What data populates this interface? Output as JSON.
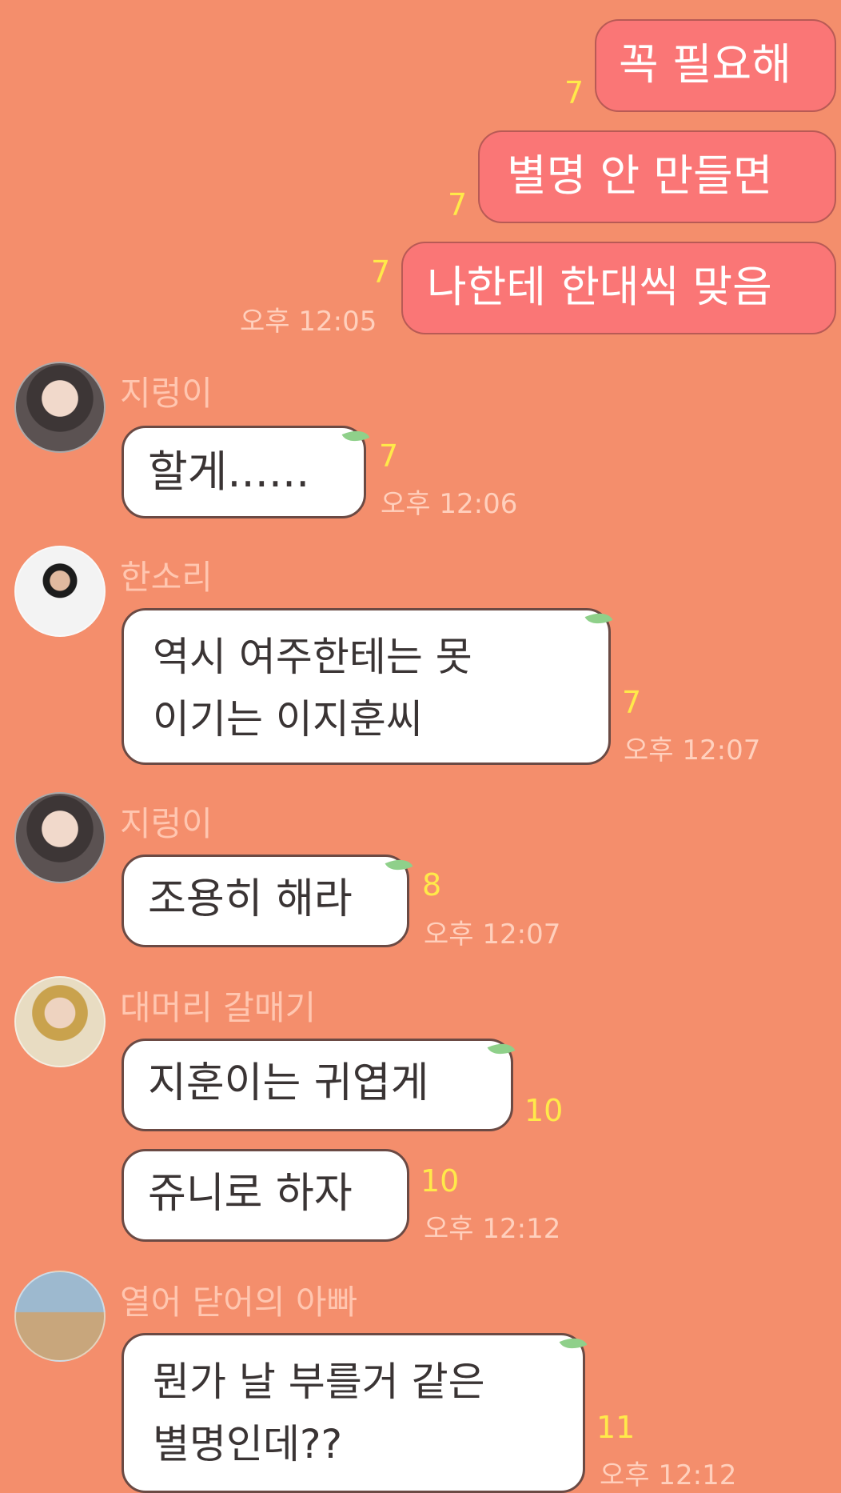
{
  "colors": {
    "background": "#f48e6c",
    "my_bubble": "#fa7676",
    "their_bubble": "#ffffff",
    "unread_count": "#ffe94a",
    "timestamp": "#ffd0bd",
    "sender_name": "#ffc6b0"
  },
  "outgoing": {
    "msg1": {
      "text": "꼭 필요해",
      "unread": "7"
    },
    "msg2": {
      "text": "별명 안 만들면",
      "unread": "7"
    },
    "msg3": {
      "text": "나한테 한대씩 맞음",
      "unread": "7",
      "time": "오후 12:05"
    }
  },
  "group1": {
    "sender": "지렁이",
    "avatar_icon": "profile-photo-icon",
    "msg1": {
      "text": "할게......",
      "unread": "7",
      "time": "오후 12:06"
    }
  },
  "group2": {
    "sender": "한소리",
    "avatar_icon": "profile-photo-icon",
    "msg1": {
      "text": "역시 여주한테는 못\n이기는 이지훈씨",
      "unread": "7",
      "time": "오후 12:07"
    }
  },
  "group3": {
    "sender": "지렁이",
    "avatar_icon": "profile-photo-icon",
    "msg1": {
      "text": "조용히 해라",
      "unread": "8",
      "time": "오후 12:07"
    }
  },
  "group4": {
    "sender": "대머리 갈매기",
    "avatar_icon": "profile-photo-icon",
    "msg1": {
      "text": "지훈이는 귀엽게",
      "unread": "10"
    },
    "msg2": {
      "text": "쥬니로 하자",
      "unread": "10",
      "time": "오후 12:12"
    }
  },
  "group5": {
    "sender": "열어 닫어의 아빠",
    "avatar_icon": "profile-photo-icon",
    "msg1": {
      "text": "뭔가 날 부를거 같은\n별명인데??",
      "unread": "11",
      "time": "오후 12:12"
    }
  }
}
